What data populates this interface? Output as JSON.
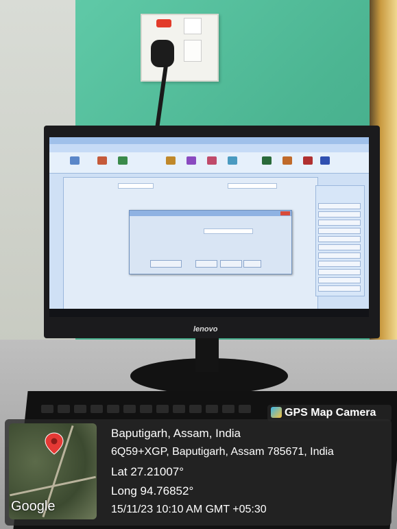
{
  "badge": {
    "label": "GPS Map Camera",
    "icon": "gps-map-camera-icon"
  },
  "location": {
    "title": "Baputigarh, Assam, India",
    "address": "6Q59+XGP, Baputigarh, Assam 785671, India",
    "lat": "Lat 27.21007°",
    "long": "Long 94.76852°",
    "datetime": "15/11/23 10:10 AM GMT +05:30"
  },
  "map": {
    "brand": "Google",
    "pin_icon": "map-pin-icon"
  },
  "monitor": {
    "brand": "lenovo"
  },
  "colors": {
    "wall": "#4cb592",
    "pin": "#e53935",
    "overlay": "#282828"
  }
}
